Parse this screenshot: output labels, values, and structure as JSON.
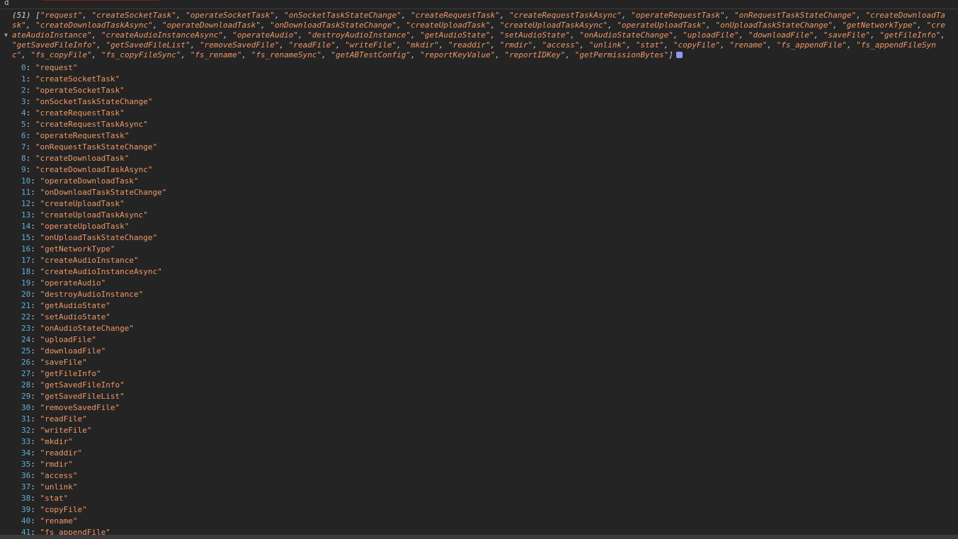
{
  "console": {
    "top_label": "d",
    "summary_count": "(51)",
    "items": [
      "request",
      "createSocketTask",
      "operateSocketTask",
      "onSocketTaskStateChange",
      "createRequestTask",
      "createRequestTaskAsync",
      "operateRequestTask",
      "onRequestTaskStateChange",
      "createDownloadTask",
      "createDownloadTaskAsync",
      "operateDownloadTask",
      "onDownloadTaskStateChange",
      "createUploadTask",
      "createUploadTaskAsync",
      "operateUploadTask",
      "onUploadTaskStateChange",
      "getNetworkType",
      "createAudioInstance",
      "createAudioInstanceAsync",
      "operateAudio",
      "destroyAudioInstance",
      "getAudioState",
      "setAudioState",
      "onAudioStateChange",
      "uploadFile",
      "downloadFile",
      "saveFile",
      "getFileInfo",
      "getSavedFileInfo",
      "getSavedFileList",
      "removeSavedFile",
      "readFile",
      "writeFile",
      "mkdir",
      "readdir",
      "rmdir",
      "access",
      "unlink",
      "stat",
      "copyFile",
      "rename",
      "fs_appendFile",
      "fs_appendFileSync",
      "fs_copyFile",
      "fs_copyFileSync",
      "fs_rename",
      "fs_renameSync",
      "getABTestConfig",
      "reportKeyValue",
      "reportIDKey",
      "getPermissionBytes"
    ],
    "visible_entry_count": 42,
    "colors": {
      "background": "#242424",
      "string": "#f29766",
      "index": "#5db0d7",
      "badge": "#8c9bf2"
    }
  }
}
